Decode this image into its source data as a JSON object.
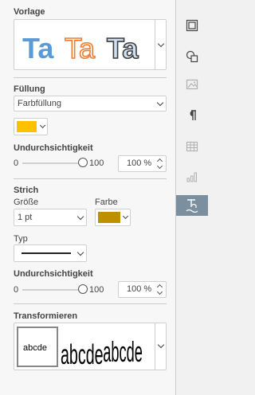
{
  "template": {
    "title": "Vorlage",
    "styles": [
      {
        "text": "Ta",
        "fill": "#5b9bd5",
        "stroke": "#5b9bd5",
        "hollow": false
      },
      {
        "text": "Ta",
        "fill": "#ffffff",
        "stroke": "#ed7d31",
        "hollow": true
      },
      {
        "text": "Ta",
        "fill": "#cfe0f3",
        "stroke": "#3c3c3c",
        "hollow": true
      }
    ]
  },
  "fill": {
    "title": "Füllung",
    "type_value": "Farbfüllung",
    "color": "#ffc000"
  },
  "fill_opacity": {
    "title": "Undurchsichtigkeit",
    "min_label": "0",
    "max_label": "100",
    "value": "100 %",
    "level": 1.0
  },
  "stroke": {
    "title": "Strich",
    "size_label": "Größe",
    "size_value": "1 pt",
    "color_label": "Farbe",
    "color": "#bf8f00",
    "type_label": "Typ"
  },
  "stroke_opacity": {
    "title": "Undurchsichtigkeit",
    "min_label": "0",
    "max_label": "100",
    "value": "100 %",
    "level": 1.0
  },
  "transform": {
    "title": "Transformieren",
    "items": [
      "abcde",
      "abcde",
      "abcde"
    ]
  },
  "toolbar": {
    "buttons": [
      "slide-settings-icon",
      "shape-settings-icon",
      "image-settings-icon",
      "paragraph-icon",
      "table-icon",
      "chart-icon",
      "textart-icon"
    ],
    "active_index": 6,
    "active_color": "#7b8f9e"
  }
}
